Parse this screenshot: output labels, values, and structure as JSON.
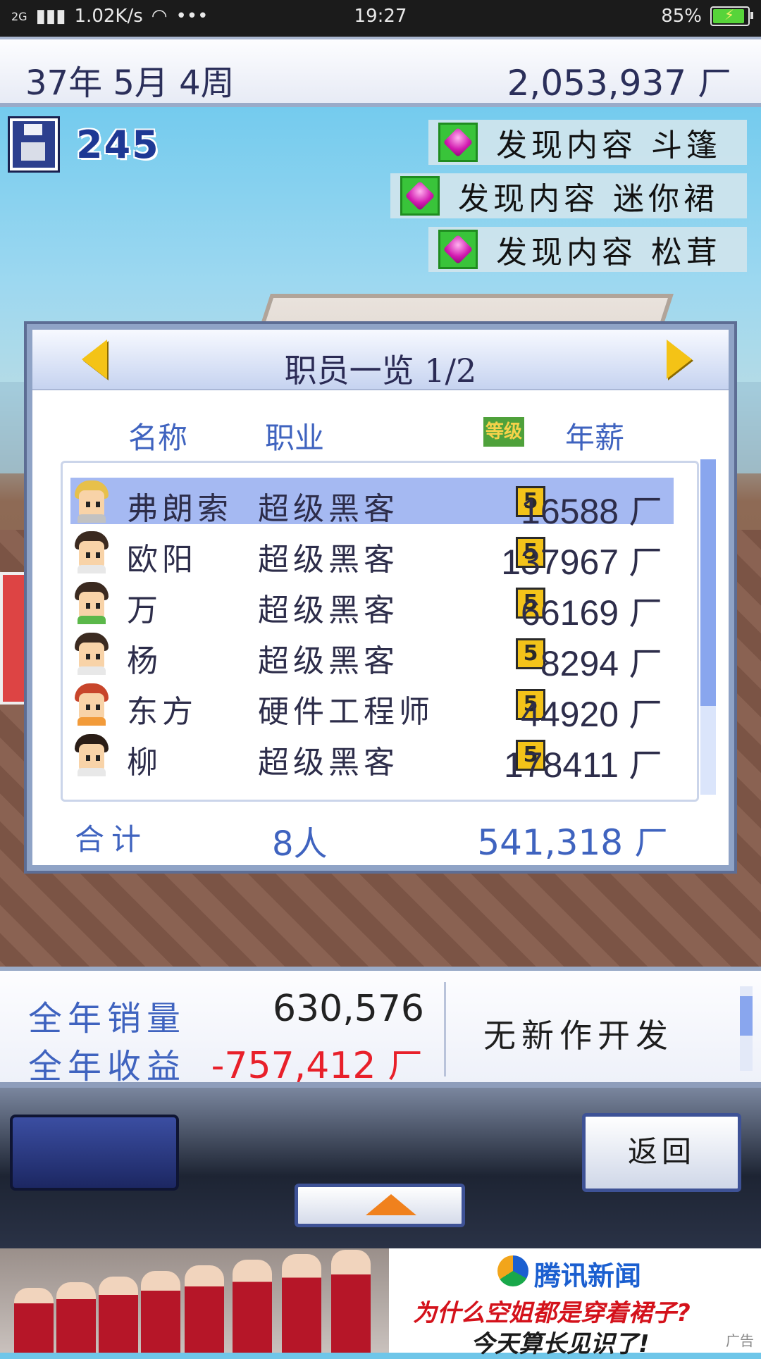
{
  "status_bar": {
    "network": "2G",
    "speed": "1.02K/s",
    "dots": "•••",
    "time": "19:27",
    "battery": "85%"
  },
  "top_bar": {
    "date": "37年 5月 4周",
    "funds": "2,053,937"
  },
  "currency_icon": "ㄏ",
  "save": {
    "count": "245",
    "icon": "floppy-disk-icon"
  },
  "notifications": [
    {
      "text": "发现内容 斗篷",
      "icon": "pink-gem-icon"
    },
    {
      "text": "发现内容 迷你裙",
      "icon": "pink-gem-icon"
    },
    {
      "text": "发现内容 松茸",
      "icon": "pink-gem-icon"
    }
  ],
  "staff_panel": {
    "title": "职员一览 1/2",
    "headers": {
      "name": "名称",
      "job": "职业",
      "level": "等级",
      "salary": "年薪"
    },
    "rows": [
      {
        "name": "弗朗索",
        "job": "超级黑客",
        "level": "5",
        "salary": "16588"
      },
      {
        "name": "欧阳",
        "job": "超级黑客",
        "level": "5",
        "salary": "137967"
      },
      {
        "name": "万",
        "job": "超级黑客",
        "level": "5",
        "salary": "66169"
      },
      {
        "name": "杨",
        "job": "超级黑客",
        "level": "5",
        "salary": "8294"
      },
      {
        "name": "东方",
        "job": "硬件工程师",
        "level": "5",
        "salary": "44920"
      },
      {
        "name": "柳",
        "job": "超级黑客",
        "level": "5",
        "salary": "178411"
      }
    ],
    "total_label": "合计",
    "total_people": "8人",
    "total_salary": "541,318"
  },
  "sales": {
    "annual_sales_label": "全年销量",
    "annual_sales_value": "630,576",
    "annual_profit_label": "全年收益",
    "annual_profit_value": "-757,412",
    "dev_status": "无新作开发"
  },
  "controls": {
    "back_label": "返回"
  },
  "ad": {
    "brand": "腾讯新闻",
    "line1": "为什么空姐都是穿着裙子?",
    "line2": "今天算长见识了!",
    "tag": "广告"
  },
  "colors": {
    "accent_blue": "#3f63bf",
    "profit_negative": "#e8202a",
    "level_badge": "#f3c319",
    "selected_row": "#a5b9f2"
  }
}
